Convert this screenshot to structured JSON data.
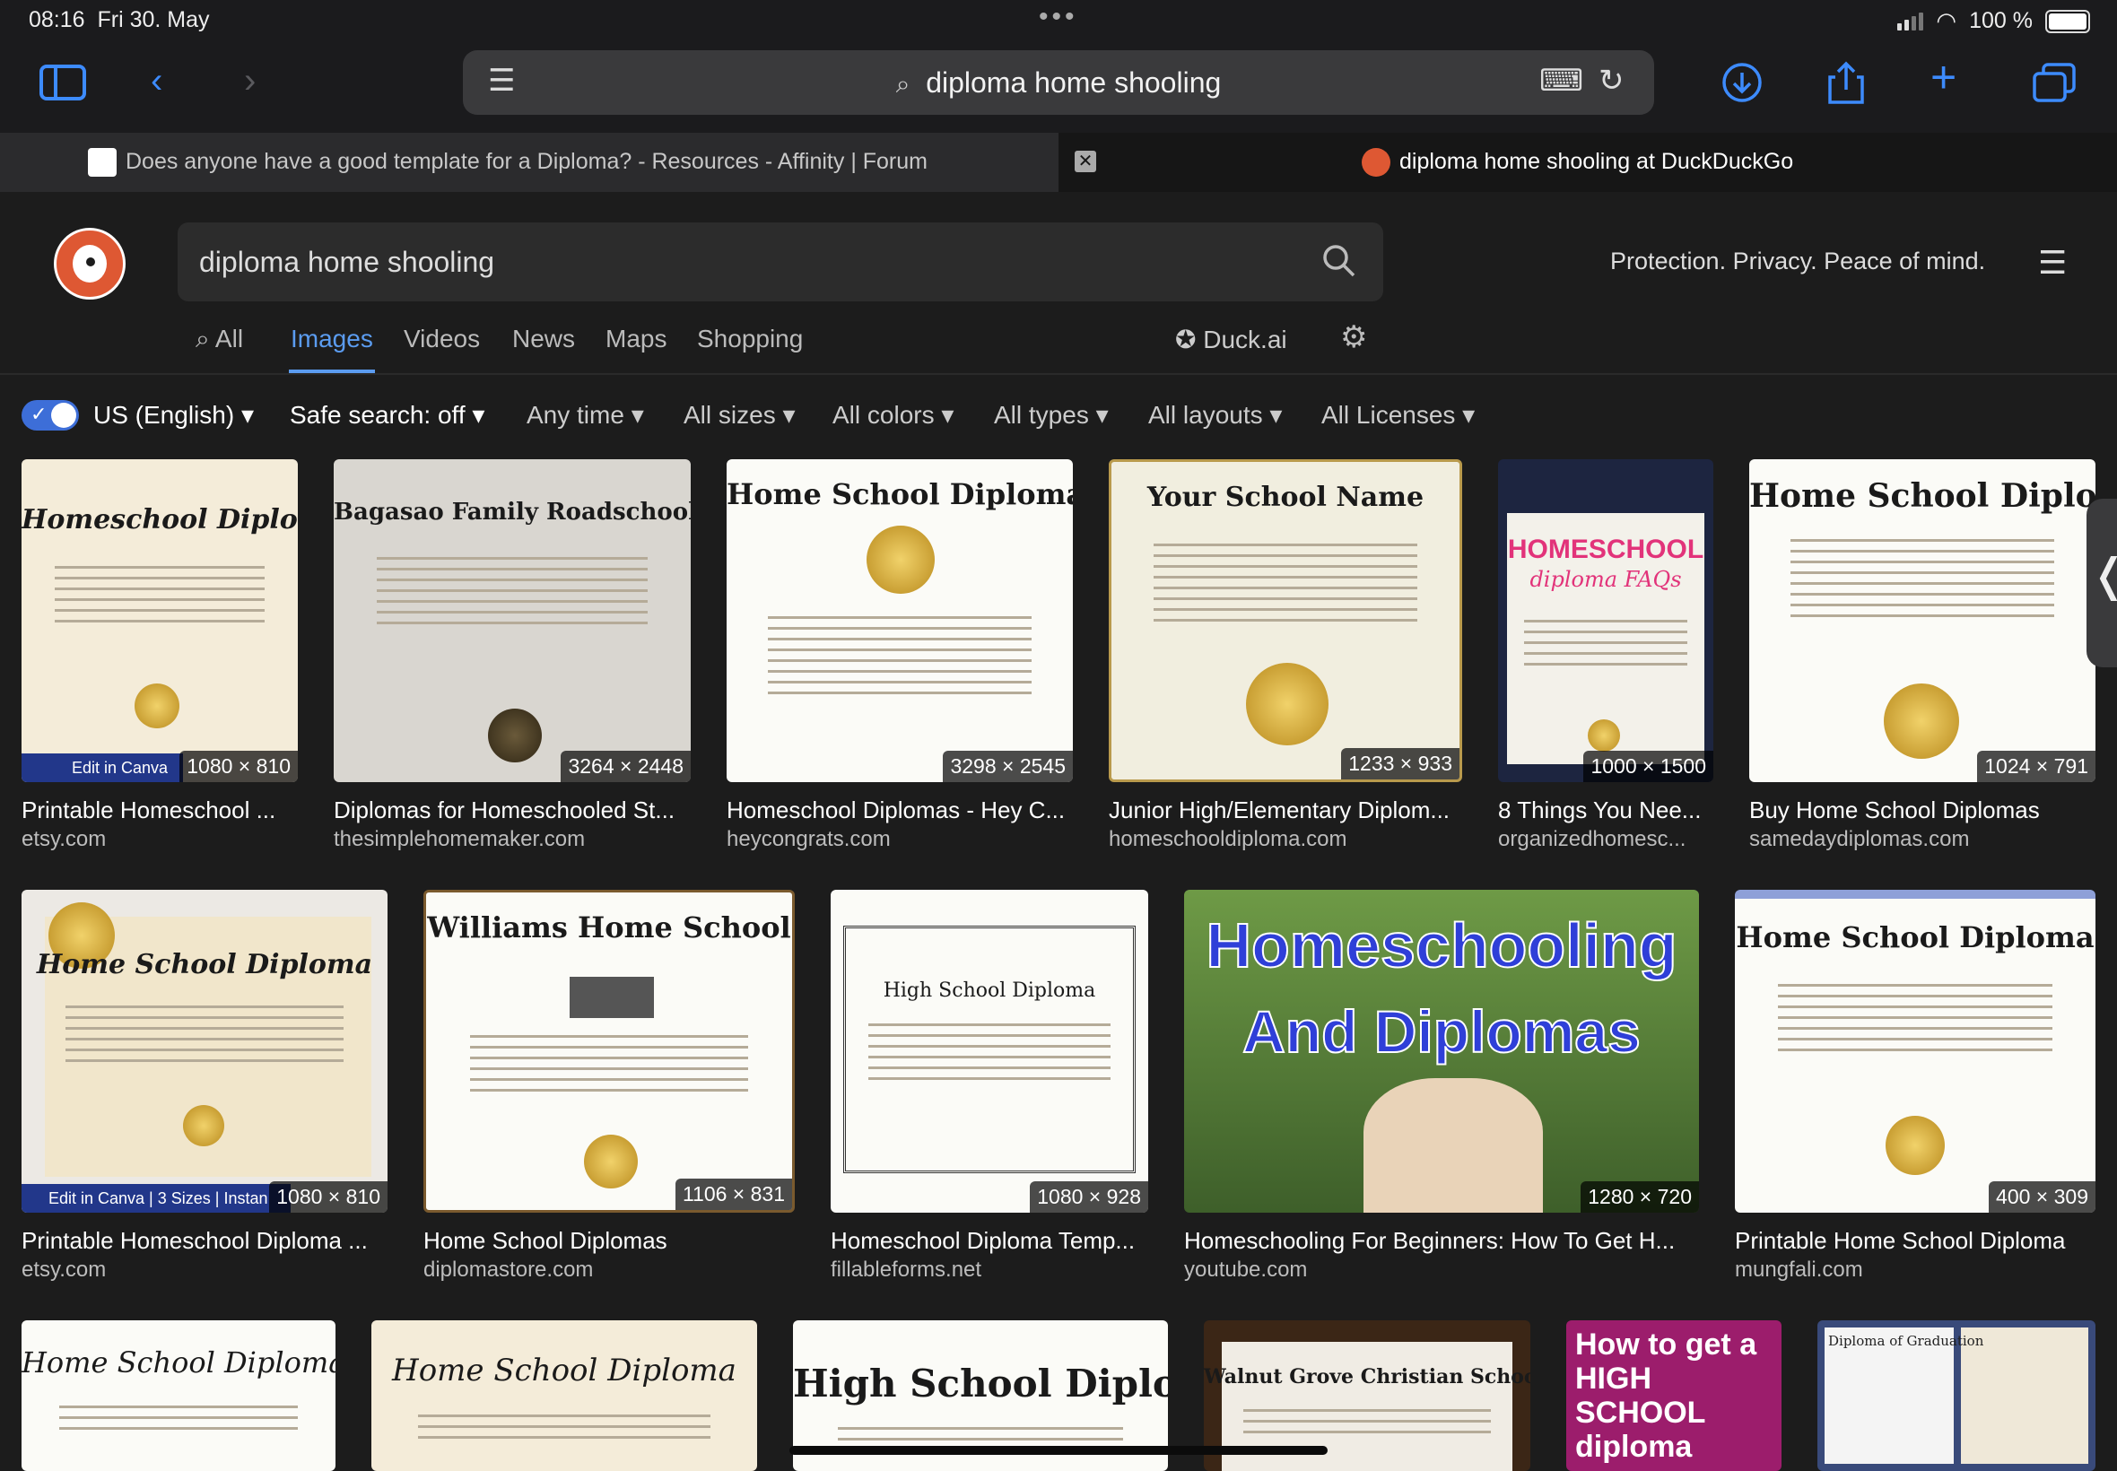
{
  "status": {
    "time": "08:16",
    "date": "Fri 30. May",
    "battery": "100 %"
  },
  "browser": {
    "url": "diploma home shooling",
    "tabs": [
      {
        "title": "Does anyone have a good template for a Diploma? - Resources - Affinity | Forum"
      },
      {
        "title": "diploma home shooling at DuckDuckGo"
      }
    ]
  },
  "ddg": {
    "query": "diploma home shooling",
    "tagline": "Protection. Privacy. Peace of mind.",
    "nav": [
      "All",
      "Images",
      "Videos",
      "News",
      "Maps",
      "Shopping"
    ],
    "duckai": "Duck.ai",
    "filters": {
      "region": "US (English)",
      "safe": "Safe search: off",
      "time": "Any time",
      "sizes": "All sizes",
      "colors": "All colors",
      "types": "All types",
      "layouts": "All layouts",
      "licenses": "All Licenses"
    }
  },
  "results": [
    {
      "title": "Printable Homeschool ...",
      "domain": "etsy.com",
      "size": "1080 × 810",
      "doc": "Homeschool Diploma",
      "overlay": "Edit in Canva"
    },
    {
      "title": "Diplomas for Homeschooled St...",
      "domain": "thesimplehomemaker.com",
      "size": "3264 × 2448",
      "doc": "Bagasao Family Roadschool"
    },
    {
      "title": "Homeschool Diplomas - Hey C...",
      "domain": "heycongrats.com",
      "size": "3298 × 2545",
      "doc": "Home School Diploma"
    },
    {
      "title": "Junior High/Elementary Diplom...",
      "domain": "homeschooldiploma.com",
      "size": "1233 × 933",
      "doc": "Your School Name"
    },
    {
      "title": "8 Things You Nee...",
      "domain": "organizedhomesc...",
      "size": "1000 × 1500",
      "doc": "HOMESCHOOL",
      "doc2": "diploma FAQs"
    },
    {
      "title": "Buy Home School Diplomas",
      "domain": "samedaydiplomas.com",
      "size": "1024 × 791",
      "doc": "Home School Diploma"
    },
    {
      "title": "Printable Homeschool Diploma ...",
      "domain": "etsy.com",
      "size": "1080 × 810",
      "doc": "Home School Diploma",
      "overlay": "Edit in Canva | 3 Sizes | Instan"
    },
    {
      "title": "Home School Diplomas",
      "domain": "diplomastore.com",
      "size": "1106 × 831",
      "doc": "Williams Home School"
    },
    {
      "title": "Homeschool Diploma Temp...",
      "domain": "fillableforms.net",
      "size": "1080 × 928",
      "doc": "High School Diploma"
    },
    {
      "title": "Homeschooling For Beginners: How To Get H...",
      "domain": "youtube.com",
      "size": "1280 × 720",
      "doc": "Homeschooling",
      "doc2": "And Diplomas"
    },
    {
      "title": "Printable Home School Diploma",
      "domain": "mungfali.com",
      "size": "400 × 309",
      "doc": "Home School Diploma"
    }
  ],
  "row3": [
    {
      "doc": "Home School Diploma"
    },
    {
      "doc": "Home School Diploma"
    },
    {
      "doc": "High School Diploma"
    },
    {
      "doc": "Walnut Grove Christian School"
    },
    {
      "doc": "How to get a HIGH SCHOOL diploma"
    },
    {
      "doc": "Diploma of Graduation"
    }
  ],
  "colors": {
    "accent": "#5b9cf0",
    "ios_blue": "#3d8bfd",
    "ddg_orange": "#de5833"
  }
}
